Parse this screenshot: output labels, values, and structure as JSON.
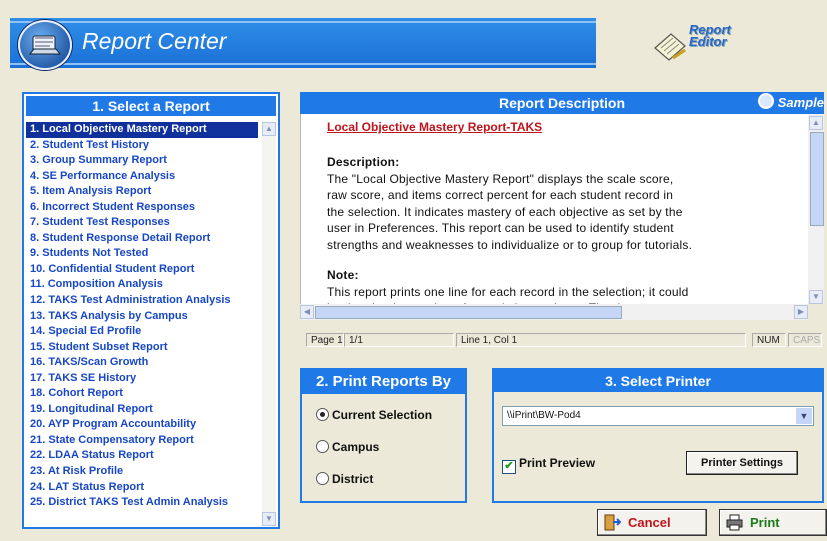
{
  "header": {
    "title": "Report Center",
    "report_editor_line1": "Report",
    "report_editor_line2": "Editor"
  },
  "select_report": {
    "heading": "1. Select a Report",
    "items": [
      "1. Local Objective Mastery Report",
      "2. Student Test History",
      "3. Group Summary Report",
      "4. SE Performance Analysis",
      "5. Item Analysis Report",
      "6. Incorrect Student Responses",
      "7. Student Test Responses",
      "8. Student Response Detail Report",
      "9. Students Not Tested",
      "10. Confidential Student Report",
      "11. Composition Analysis",
      "12. TAKS Test Administration Analysis",
      "13. TAKS Analysis by Campus",
      "14. Special Ed Profile",
      "15. Student Subset Report",
      "16. TAKS/Scan Growth",
      "17. TAKS SE History",
      "18. Cohort Report",
      "19. Longitudinal Report",
      "20. AYP Program Accountability",
      "21. State Compensatory Report",
      "22. LDAA Status Report",
      "23. At Risk Profile",
      "24. LAT Status Report",
      "25. District TAKS Test  Admin Analysis"
    ],
    "selected_index": 0
  },
  "description": {
    "heading": "Report Description",
    "sample_label": "Sample",
    "title": "Local Objective Mastery Report-TAKS",
    "desc_heading": "Description:",
    "desc_lines": [
      "The \"Local Objective Mastery Report\" displays the scale score,",
      "raw score, and items  correct percent for each student record in",
      "the selection. It indicates mastery of each  objective as set by the",
      "user in Preferences. This report can be used to identify student",
      "strengths and weaknesses to individualize or to group for tutorials."
    ],
    "note_heading": "Note:",
    "note_lines": [
      "This report prints one line for each record in the selection; it could",
      "be that the the number of records is very large. The data..."
    ]
  },
  "status_bar": {
    "page": "Page 1",
    "pages": "1/1",
    "position": "Line 1, Col 1",
    "num": "NUM",
    "caps": "CAPS"
  },
  "print_by": {
    "heading": "2. Print Reports By",
    "options": [
      "Current Selection",
      "Campus",
      "District"
    ],
    "selected": 0
  },
  "printer": {
    "heading": "3. Select Printer",
    "selected_printer": "\\\\iPrint\\BW-Pod4",
    "preview_label": "Print Preview",
    "preview_checked": true,
    "settings_label": "Printer Settings"
  },
  "actions": {
    "cancel_label": "Cancel",
    "print_label": "Print"
  },
  "colors": {
    "accent": "#1f7ae8",
    "list_text": "#1747c6",
    "selected_bg": "#10309c",
    "title_red": "#c0141c"
  }
}
